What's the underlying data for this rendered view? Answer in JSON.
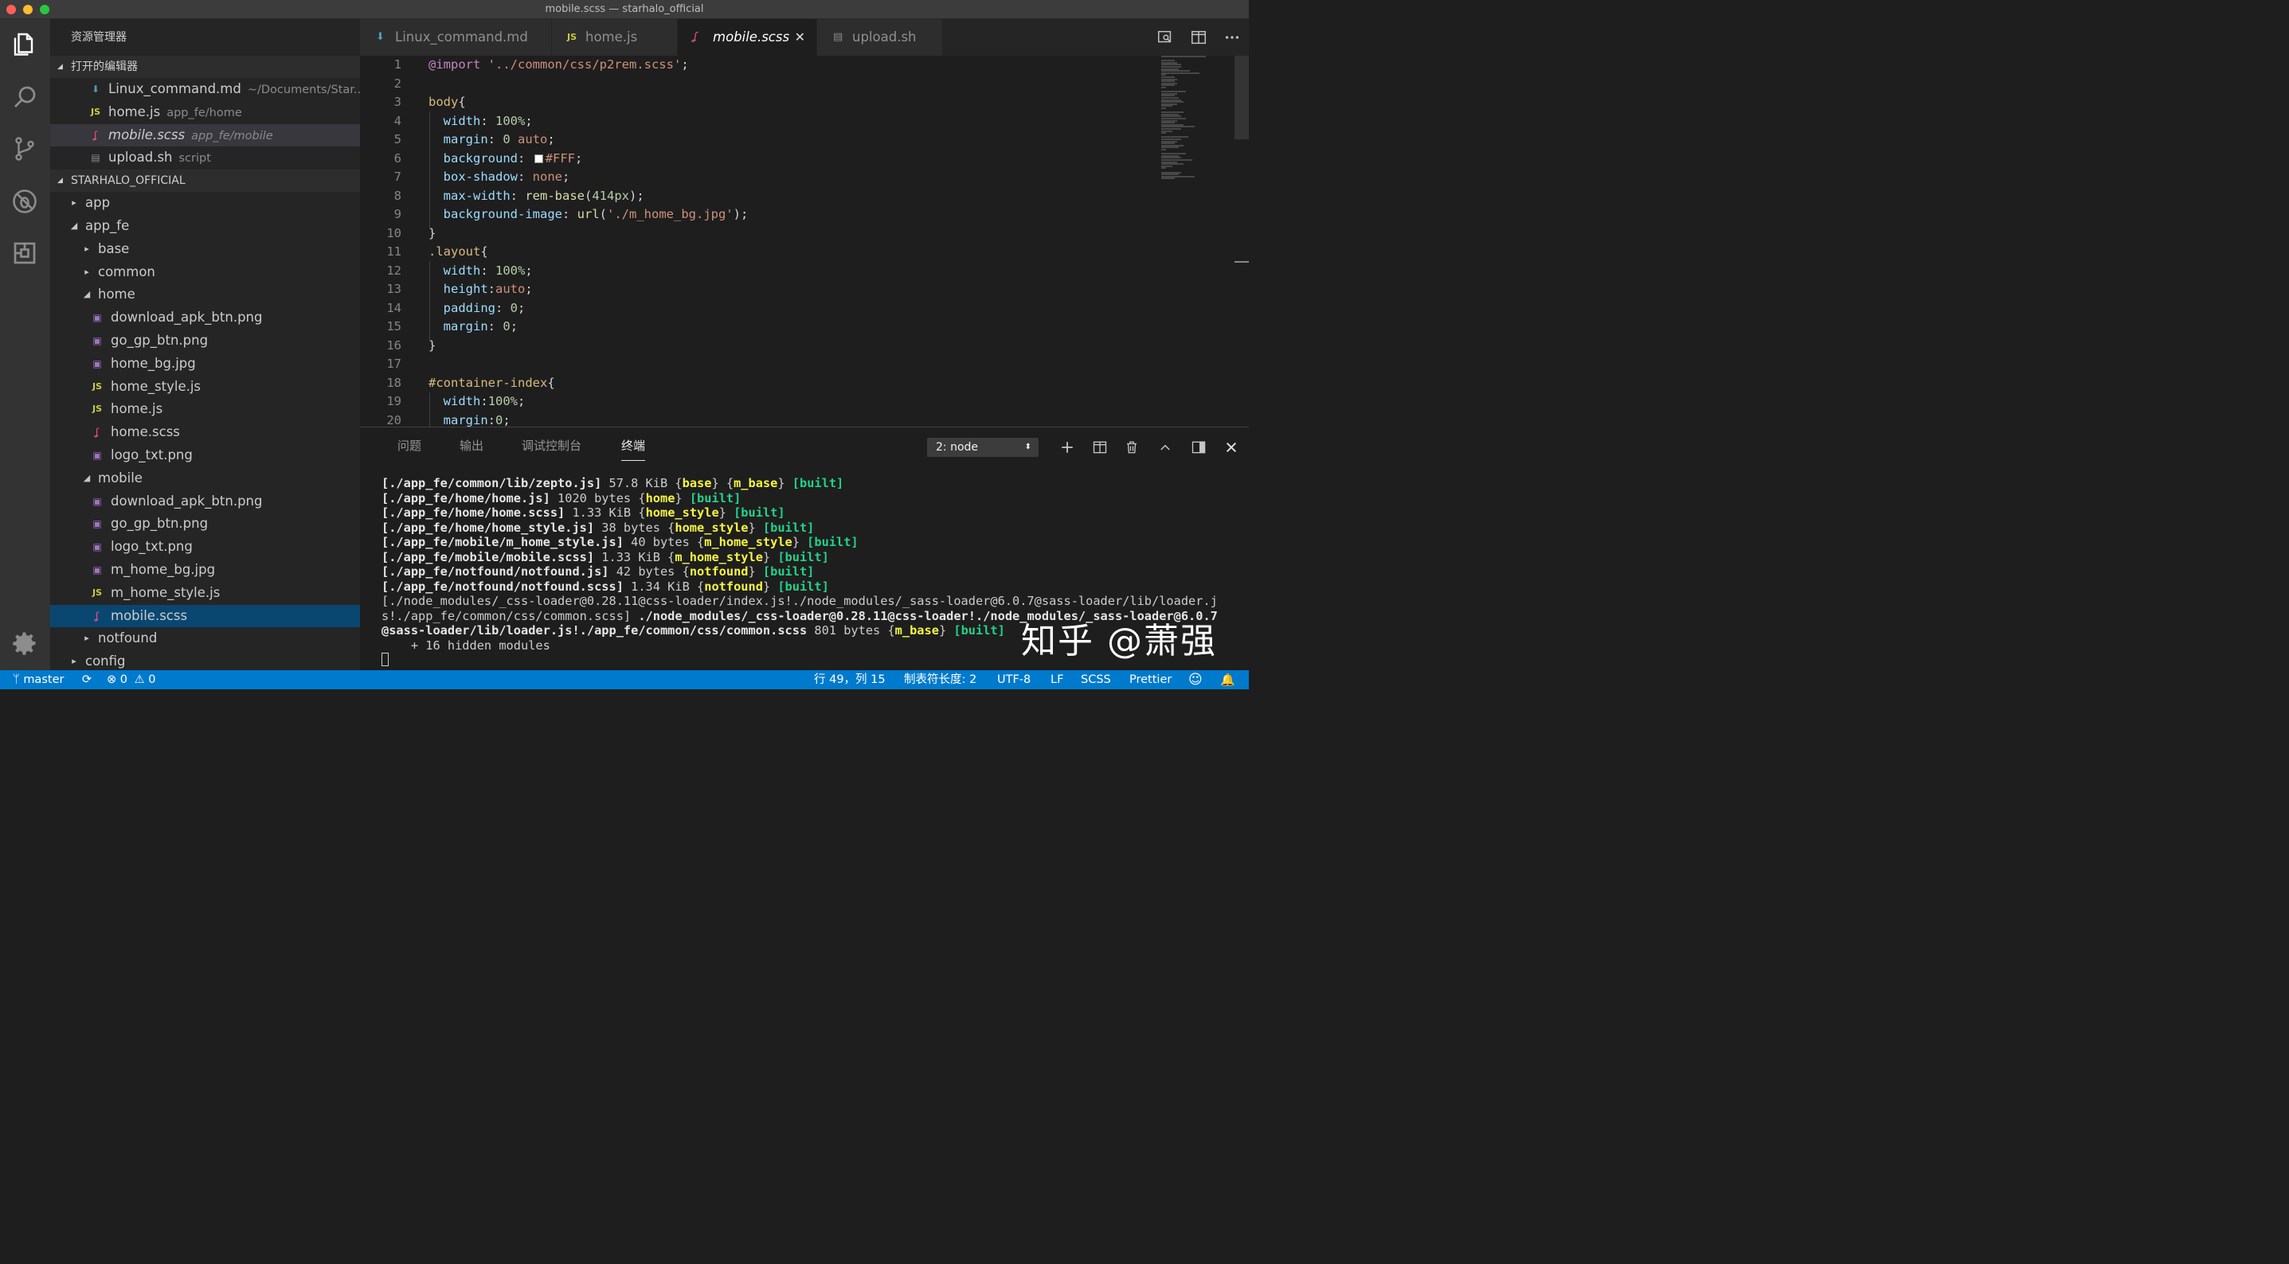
{
  "window": {
    "title": "mobile.scss — starhalo_official"
  },
  "activitybar": {
    "icons": [
      "files-icon",
      "search-icon",
      "source-control-icon",
      "debug-icon",
      "extensions-icon",
      "settings-gear-icon"
    ]
  },
  "sidebar": {
    "title": "资源管理器",
    "open_editors": {
      "header": "打开的编辑器",
      "items": [
        {
          "name": "Linux_command.md",
          "desc": "~/Documents/Star...",
          "icon": "markdown-icon"
        },
        {
          "name": "home.js",
          "desc": "app_fe/home",
          "icon": "js-icon"
        },
        {
          "name": "mobile.scss",
          "desc": "app_fe/mobile",
          "icon": "scss-icon"
        },
        {
          "name": "upload.sh",
          "desc": "script",
          "icon": "shell-icon"
        }
      ]
    },
    "project": {
      "header": "STARHALO_OFFICIAL",
      "items": [
        {
          "name": "app"
        },
        {
          "name": "app_fe"
        },
        {
          "name": "base"
        },
        {
          "name": "common"
        },
        {
          "name": "home"
        },
        {
          "name": "download_apk_btn.png"
        },
        {
          "name": "go_gp_btn.png"
        },
        {
          "name": "home_bg.jpg"
        },
        {
          "name": "home_style.js"
        },
        {
          "name": "home.js"
        },
        {
          "name": "home.scss"
        },
        {
          "name": "logo_txt.png"
        },
        {
          "name": "mobile"
        },
        {
          "name": "download_apk_btn.png"
        },
        {
          "name": "go_gp_btn.png"
        },
        {
          "name": "logo_txt.png"
        },
        {
          "name": "m_home_bg.jpg"
        },
        {
          "name": "m_home_style.js"
        },
        {
          "name": "mobile.scss"
        },
        {
          "name": "notfound"
        },
        {
          "name": "config"
        }
      ]
    }
  },
  "tabs": [
    {
      "label": "Linux_command.md",
      "icon": "markdown-icon"
    },
    {
      "label": "home.js",
      "icon": "js-icon"
    },
    {
      "label": "mobile.scss",
      "icon": "scss-icon"
    },
    {
      "label": "upload.sh",
      "icon": "shell-icon"
    }
  ],
  "js_badge": "JS",
  "editor": {
    "lines": [
      {
        "n": "1",
        "t": [
          [
            "kw",
            "@import"
          ],
          [
            "pl",
            " "
          ],
          [
            "str",
            "'../common/css/p2rem.scss'"
          ],
          [
            "pl",
            ";"
          ]
        ]
      },
      {
        "n": "2",
        "t": []
      },
      {
        "n": "3",
        "t": [
          [
            "sel",
            "body"
          ],
          [
            "pl",
            "{"
          ]
        ]
      },
      {
        "n": "4",
        "t": [
          [
            "pl",
            "  "
          ],
          [
            "prop",
            "width"
          ],
          [
            "pl",
            ": "
          ],
          [
            "num",
            "100%"
          ],
          [
            "pl",
            ";"
          ]
        ]
      },
      {
        "n": "5",
        "t": [
          [
            "pl",
            "  "
          ],
          [
            "prop",
            "margin"
          ],
          [
            "pl",
            ": "
          ],
          [
            "num",
            "0"
          ],
          [
            "pl",
            " "
          ],
          [
            "str",
            "auto"
          ],
          [
            "pl",
            ";"
          ]
        ]
      },
      {
        "n": "6",
        "t": [
          [
            "pl",
            "  "
          ],
          [
            "prop",
            "background"
          ],
          [
            "pl",
            ": "
          ],
          [
            "swatch",
            ""
          ],
          [
            "str",
            "#FFF"
          ],
          [
            "pl",
            ";"
          ]
        ]
      },
      {
        "n": "7",
        "t": [
          [
            "pl",
            "  "
          ],
          [
            "prop",
            "box-shadow"
          ],
          [
            "pl",
            ": "
          ],
          [
            "str",
            "none"
          ],
          [
            "pl",
            ";"
          ]
        ]
      },
      {
        "n": "8",
        "t": [
          [
            "pl",
            "  "
          ],
          [
            "prop",
            "max-width"
          ],
          [
            "pl",
            ": "
          ],
          [
            "fn",
            "rem-base"
          ],
          [
            "pl",
            "("
          ],
          [
            "num",
            "414px"
          ],
          [
            "pl",
            ");"
          ]
        ]
      },
      {
        "n": "9",
        "t": [
          [
            "pl",
            "  "
          ],
          [
            "prop",
            "background-image"
          ],
          [
            "pl",
            ": "
          ],
          [
            "fn",
            "url"
          ],
          [
            "pl",
            "("
          ],
          [
            "str",
            "'./m_home_bg.jpg'"
          ],
          [
            "pl",
            ");"
          ]
        ]
      },
      {
        "n": "10",
        "t": [
          [
            "pl",
            "}"
          ]
        ]
      },
      {
        "n": "11",
        "t": [
          [
            "sel",
            ".layout"
          ],
          [
            "pl",
            "{"
          ]
        ]
      },
      {
        "n": "12",
        "t": [
          [
            "pl",
            "  "
          ],
          [
            "prop",
            "width"
          ],
          [
            "pl",
            ": "
          ],
          [
            "num",
            "100%"
          ],
          [
            "pl",
            ";"
          ]
        ]
      },
      {
        "n": "13",
        "t": [
          [
            "pl",
            "  "
          ],
          [
            "prop",
            "height"
          ],
          [
            "pl",
            ":"
          ],
          [
            "str",
            "auto"
          ],
          [
            "pl",
            ";"
          ]
        ]
      },
      {
        "n": "14",
        "t": [
          [
            "pl",
            "  "
          ],
          [
            "prop",
            "padding"
          ],
          [
            "pl",
            ": "
          ],
          [
            "num",
            "0"
          ],
          [
            "pl",
            ";"
          ]
        ]
      },
      {
        "n": "15",
        "t": [
          [
            "pl",
            "  "
          ],
          [
            "prop",
            "margin"
          ],
          [
            "pl",
            ": "
          ],
          [
            "num",
            "0"
          ],
          [
            "pl",
            ";"
          ]
        ]
      },
      {
        "n": "16",
        "t": [
          [
            "pl",
            "}"
          ]
        ]
      },
      {
        "n": "17",
        "t": []
      },
      {
        "n": "18",
        "t": [
          [
            "sel",
            "#container-index"
          ],
          [
            "pl",
            "{"
          ]
        ]
      },
      {
        "n": "19",
        "t": [
          [
            "pl",
            "  "
          ],
          [
            "prop",
            "width"
          ],
          [
            "pl",
            ":"
          ],
          [
            "num",
            "100%"
          ],
          [
            "pl",
            ";"
          ]
        ]
      },
      {
        "n": "20",
        "t": [
          [
            "pl",
            "  "
          ],
          [
            "prop",
            "margin"
          ],
          [
            "pl",
            ":"
          ],
          [
            "num",
            "0"
          ],
          [
            "pl",
            ";"
          ]
        ]
      }
    ]
  },
  "panel": {
    "tabs": [
      "问题",
      "输出",
      "调试控制台",
      "终端"
    ],
    "terminal_select": "2: node",
    "terminal_lines": [
      [
        [
          "b",
          "[./app_fe/common/lib/zepto.js]"
        ],
        [
          "n",
          " 57.8 KiB {"
        ],
        [
          "y",
          "base"
        ],
        [
          "n",
          "} {"
        ],
        [
          "y",
          "m_base"
        ],
        [
          "n",
          "} "
        ],
        [
          "g",
          "[built]"
        ]
      ],
      [
        [
          "b",
          "[./app_fe/home/home.js]"
        ],
        [
          "n",
          " 1020 bytes {"
        ],
        [
          "y",
          "home"
        ],
        [
          "n",
          "} "
        ],
        [
          "g",
          "[built]"
        ]
      ],
      [
        [
          "b",
          "[./app_fe/home/home.scss]"
        ],
        [
          "n",
          " 1.33 KiB {"
        ],
        [
          "y",
          "home_style"
        ],
        [
          "n",
          "} "
        ],
        [
          "g",
          "[built]"
        ]
      ],
      [
        [
          "b",
          "[./app_fe/home/home_style.js]"
        ],
        [
          "n",
          " 38 bytes {"
        ],
        [
          "y",
          "home_style"
        ],
        [
          "n",
          "} "
        ],
        [
          "g",
          "[built]"
        ]
      ],
      [
        [
          "b",
          "[./app_fe/mobile/m_home_style.js]"
        ],
        [
          "n",
          " 40 bytes {"
        ],
        [
          "y",
          "m_home_style"
        ],
        [
          "n",
          "} "
        ],
        [
          "g",
          "[built]"
        ]
      ],
      [
        [
          "b",
          "[./app_fe/mobile/mobile.scss]"
        ],
        [
          "n",
          " 1.33 KiB {"
        ],
        [
          "y",
          "m_home_style"
        ],
        [
          "n",
          "} "
        ],
        [
          "g",
          "[built]"
        ]
      ],
      [
        [
          "b",
          "[./app_fe/notfound/notfound.js]"
        ],
        [
          "n",
          " 42 bytes {"
        ],
        [
          "y",
          "notfound"
        ],
        [
          "n",
          "} "
        ],
        [
          "g",
          "[built]"
        ]
      ],
      [
        [
          "b",
          "[./app_fe/notfound/notfound.scss]"
        ],
        [
          "n",
          " 1.34 KiB {"
        ],
        [
          "y",
          "notfound"
        ],
        [
          "n",
          "} "
        ],
        [
          "g",
          "[built]"
        ]
      ],
      [
        [
          "n",
          "[./node_modules/_css-loader@0.28.11@css-loader/index.js!./node_modules/_sass-loader@6.0.7@sass-loader/lib/loader.j"
        ]
      ],
      [
        [
          "n",
          "s!./app_fe/common/css/common.scss] "
        ],
        [
          "b",
          "./node_modules/_css-loader@0.28.11@css-loader!./node_modules/_sass-loader@6.0.7"
        ]
      ],
      [
        [
          "b",
          "@sass-loader/lib/loader.js!./app_fe/common/css/common.scss"
        ],
        [
          "n",
          " 801 bytes {"
        ],
        [
          "y",
          "m_base"
        ],
        [
          "n",
          "} "
        ],
        [
          "g",
          "[built]"
        ]
      ],
      [
        [
          "n",
          "    + 16 hidden modules"
        ]
      ]
    ],
    "watermark": "知乎 @萧强"
  },
  "statusbar": {
    "branch": "master",
    "errors": "0",
    "warnings": "0",
    "position": "行 49，列 15",
    "tab_size": "制表符长度: 2",
    "encoding": "UTF-8",
    "eol": "LF",
    "language": "SCSS",
    "formatter": "Prettier"
  },
  "colors": {
    "accent": "#007acc",
    "selection": "#094771",
    "editor_bg": "#1e1e1e",
    "sidebar_bg": "#252526"
  }
}
